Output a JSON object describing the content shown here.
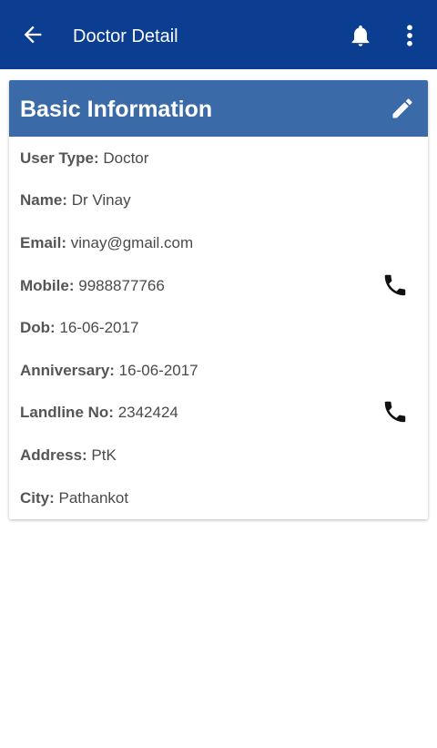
{
  "appbar": {
    "title": "Doctor Detail",
    "back_icon": "arrow-left-icon",
    "bell_icon": "bell-icon",
    "more_icon": "more-vertical-icon",
    "bg_color": "#0b3d91"
  },
  "card": {
    "title": "Basic Information",
    "edit_icon": "pencil-icon",
    "header_color": "#3a6aa8",
    "fields": [
      {
        "label": "User Type:",
        "value": "Doctor"
      },
      {
        "label": "Name:",
        "value": "Dr Vinay"
      },
      {
        "label": "Email:",
        "value": "vinay@gmail.com"
      },
      {
        "label": "Mobile:",
        "value": "9988877766",
        "icon": "phone-icon"
      },
      {
        "label": "Dob:",
        "value": "16-06-2017"
      },
      {
        "label": "Anniversary:",
        "value": "16-06-2017"
      },
      {
        "label": "Landline No:",
        "value": "2342424",
        "icon": "phone-icon"
      },
      {
        "label": "Address:",
        "value": "PtK"
      },
      {
        "label": "City:",
        "value": "Pathankot"
      }
    ]
  }
}
